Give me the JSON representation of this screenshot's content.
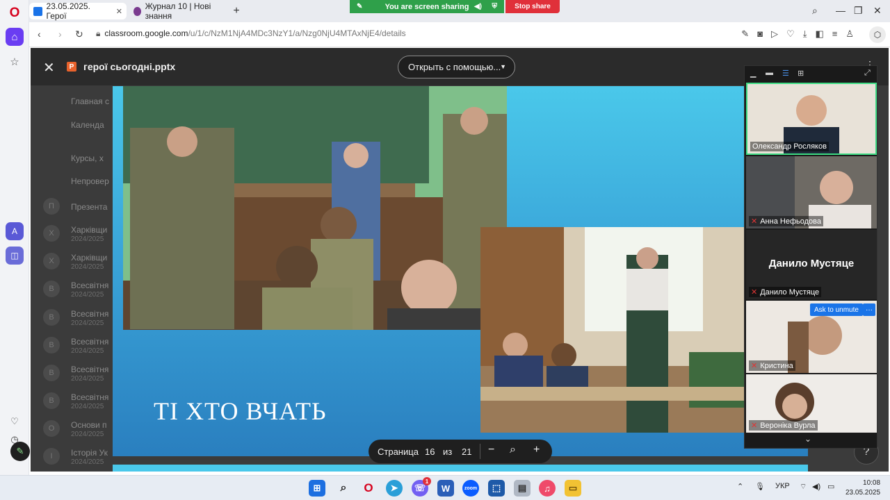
{
  "browser": {
    "tabs": [
      {
        "label": "23.05.2025. Герої",
        "close": "✕",
        "favicon_color": "#1a73e8"
      },
      {
        "label": "Журнал 10 | Нові знання",
        "close": "",
        "favicon_color": "#7a3b8f"
      }
    ],
    "new_tab": "+",
    "url_host": "classroom.google.com",
    "url_path": "/u/1/c/NzM1NjA4MDc3NzY1/a/Nzg0NjU4MTAxNjE4/details",
    "screen_share": {
      "banner": "You are screen sharing",
      "stop": "Stop share"
    }
  },
  "viewer": {
    "file_title": "герої сьогодні.pptx",
    "file_badge": "P",
    "open_with": "Открыть с помощью...",
    "slide": {
      "heading": "ТІ ХТО ВЧАТЬ"
    },
    "pager": {
      "label": "Страница",
      "current": "16",
      "of": "из",
      "total": "21"
    }
  },
  "classroom_bg": {
    "nav": [
      "Главная с",
      "Календа",
      "Курсы, х",
      "Непровер"
    ],
    "courses": [
      {
        "letter": "П",
        "name": "Презента",
        "sub": ""
      },
      {
        "letter": "Х",
        "name": "Харківщи",
        "sub": "2024/2025"
      },
      {
        "letter": "Х",
        "name": "Харківщи",
        "sub": "2024/2025"
      },
      {
        "letter": "В",
        "name": "Всесвітня",
        "sub": "2024/2025"
      },
      {
        "letter": "В",
        "name": "Всесвітня",
        "sub": "2024/2025"
      },
      {
        "letter": "В",
        "name": "Всесвітня",
        "sub": "2024/2025"
      },
      {
        "letter": "В",
        "name": "Всесвітня",
        "sub": "2024/2025"
      },
      {
        "letter": "В",
        "name": "Всесвітня",
        "sub": "2024/2025"
      },
      {
        "letter": "О",
        "name": "Основи п",
        "sub": "2024/2025"
      },
      {
        "letter": "І",
        "name": "Історія Ук",
        "sub": "2024/2025"
      }
    ]
  },
  "zoom": {
    "participants": [
      {
        "name": "Олександр Росляков",
        "muted": false
      },
      {
        "name": "Анна Нефьодова",
        "muted": true
      },
      {
        "name": "Данило Мустяце",
        "muted": true,
        "video_off": true
      },
      {
        "name": "Кристина",
        "muted": true
      },
      {
        "name": "Вероніка Вурла",
        "muted": true
      }
    ],
    "ask_to_unmute": "Ask to unmute",
    "more": "···"
  },
  "taskbar": {
    "lang": "УКР",
    "time": "10:08",
    "date": "23.05.2025",
    "viber_badge": "1"
  },
  "colors": {
    "accent_share": "#2fa04a",
    "stop_share": "#e0303a",
    "opera_accent": "#6a3df2",
    "zoom_blue": "#1a74e8"
  }
}
